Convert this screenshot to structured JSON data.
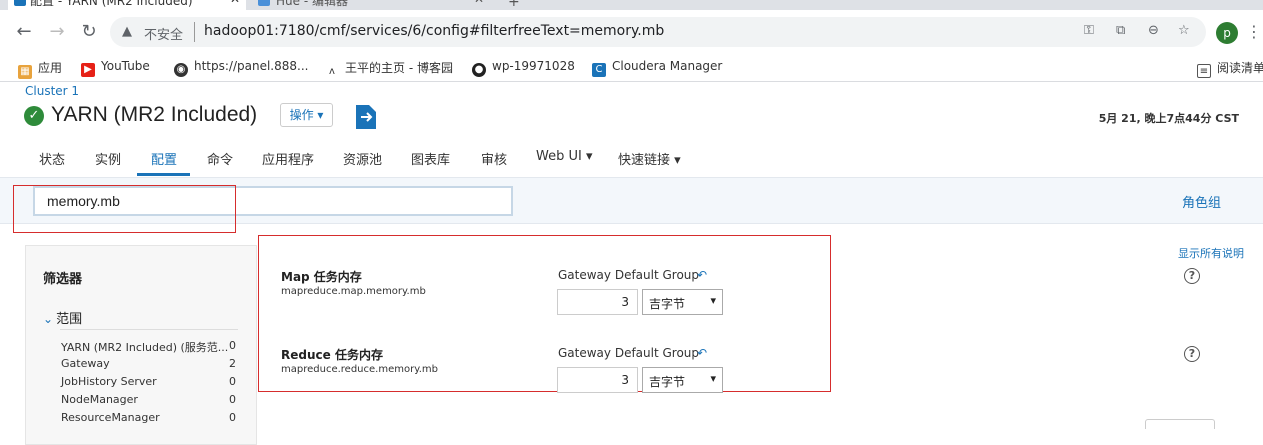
{
  "browser": {
    "tabs": [
      {
        "title": "配置 - YARN (MR2 Included)"
      },
      {
        "title": "Hue - 编辑器"
      }
    ],
    "address": {
      "security_label": "不安全",
      "url": "hadoop01:7180/cmf/services/6/config#filterfreeText=memory.mb"
    },
    "avatar_letter": "p",
    "bookmarks": [
      {
        "label": "应用",
        "icon": "apps-icon"
      },
      {
        "label": "YouTube",
        "icon": "youtube-icon"
      },
      {
        "label": "https://panel.888...",
        "icon": "globe-icon"
      },
      {
        "label": "王平的主页 - 博客园",
        "icon": "blog-icon"
      },
      {
        "label": "wp-19971028",
        "icon": "github-icon"
      },
      {
        "label": "Cloudera Manager",
        "icon": "cloudera-icon"
      }
    ],
    "reading_list": "阅读清单"
  },
  "page": {
    "breadcrumb": "Cluster 1",
    "service_title": "YARN (MR2 Included)",
    "actions_label": "操作",
    "timestamp": "5月 21, 晚上7点44分 CST",
    "nav_tabs": [
      "状态",
      "实例",
      "配置",
      "命令",
      "应用程序",
      "资源池",
      "图表库",
      "审核",
      "Web UI",
      "快速链接"
    ],
    "active_tab": "配置",
    "filter": {
      "value": "memory.mb"
    },
    "role_group_link": "角色组",
    "show_all_desc": "显示所有说明",
    "sidebar": {
      "title": "筛选器",
      "scope_title": "范围",
      "scope_items": [
        {
          "label": "YARN (MR2 Included) (服务范...",
          "count": "0"
        },
        {
          "label": "Gateway",
          "count": "2"
        },
        {
          "label": "JobHistory Server",
          "count": "0"
        },
        {
          "label": "NodeManager",
          "count": "0"
        },
        {
          "label": "ResourceManager",
          "count": "0"
        }
      ]
    },
    "properties": [
      {
        "name": "Map 任务内存",
        "key": "mapreduce.map.memory.mb",
        "group": "Gateway Default Group",
        "value": "3",
        "unit": "吉字节"
      },
      {
        "name": "Reduce 任务内存",
        "key": "mapreduce.reduce.memory.mb",
        "group": "Gateway Default Group",
        "value": "3",
        "unit": "吉字节"
      }
    ],
    "colors": {
      "link": "#1a73b8",
      "success": "#2e8b3a",
      "highlight": "#d62d2d"
    }
  }
}
